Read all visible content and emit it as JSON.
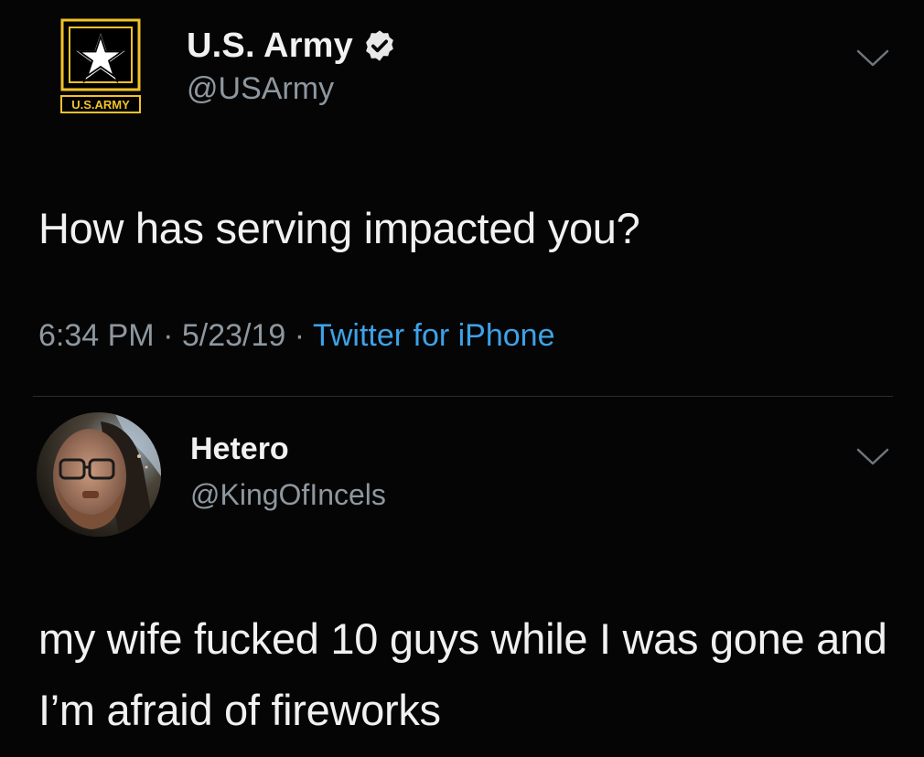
{
  "tweet": {
    "author_name": "U.S. Army",
    "author_handle": "@USArmy",
    "logo_text": "U.S.ARMY",
    "text": "How has serving impacted you?",
    "time": "6:34 PM",
    "date": "5/23/19",
    "separator": "·",
    "source": "Twitter for iPhone"
  },
  "reply": {
    "author_name": "Hetero",
    "author_handle": "@KingOfIncels",
    "text": "my wife fucked 10 guys while I was gone and I’m afraid of fireworks"
  },
  "icons": {
    "verified": "verified-badge-icon",
    "menu": "chevron-down-icon",
    "logo": "army-star-logo"
  },
  "colors": {
    "background": "#050505",
    "text": "#f1f1f1",
    "secondary_text": "#8e979f",
    "link": "#3da2e8",
    "logo_gold": "#f2c229"
  }
}
